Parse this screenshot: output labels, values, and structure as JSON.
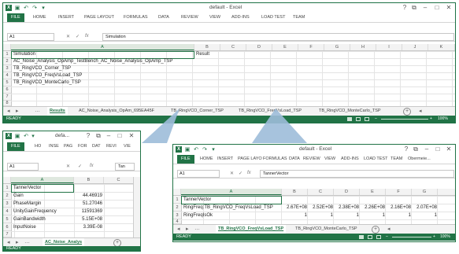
{
  "main": {
    "title": "default - Excel",
    "ribbon": [
      "FILE",
      "HOME",
      "INSERT",
      "PAGE LAYOUT",
      "FORMULAS",
      "DATA",
      "REVIEW",
      "VIEW",
      "ADD-INS",
      "LOAD TEST",
      "TEAM"
    ],
    "name_box": "A1",
    "formula": "Simulation",
    "columns": [
      "A",
      "B",
      "C",
      "D",
      "E",
      "F",
      "G",
      "H",
      "I",
      "J",
      "K"
    ],
    "rows": [
      "1",
      "2",
      "3",
      "4",
      "5",
      "6",
      "7",
      "8"
    ],
    "cells": [
      [
        "Simulation",
        "Result"
      ],
      [
        "AC_Noise_Analysis_OpAmp_TestBench_AC_Noise_Analysis_OpAmp_TSP",
        ""
      ],
      [
        "TB_RingVCO_Corner_TSP",
        ""
      ],
      [
        "TB_RingVCO_FreqVsLoad_TSP",
        ""
      ],
      [
        "TB_RingVCO_MonteCarlo_TSP",
        ""
      ]
    ],
    "tabs": [
      "Results",
      "AC_Noise_Analysis_OpAm_695EA45F",
      "TB_RingVCO_Corner_TSP",
      "TB_RingVCO_FreqVsLoad_TSP",
      "TB_RingVCO_MonteCarlo_TSP"
    ],
    "status": "READY",
    "zoom": "100%"
  },
  "left": {
    "title": "defa...",
    "ribbon": [
      "FILE",
      "HO",
      "INSE",
      "PAG",
      "FOR",
      "DAT",
      "REVI",
      "VIE"
    ],
    "name_box": "A1",
    "formula": "Tan",
    "columns": [
      "A",
      "B",
      "C"
    ],
    "rows": [
      "1",
      "2",
      "3",
      "4",
      "5",
      "6",
      "7",
      "8"
    ],
    "cells": [
      [
        "TannerVector",
        ""
      ],
      [
        "Gain",
        "44.46919"
      ],
      [
        "PhaseMargin",
        "51.27046"
      ],
      [
        "UnityGainFrequency",
        "11591369"
      ],
      [
        "GainBandwidth",
        "5.15E+08"
      ],
      [
        "InputNoise",
        "3.39E-08"
      ]
    ],
    "tab": "AC_Noise_Analys",
    "status": "READY"
  },
  "right": {
    "title": "default - Excel",
    "ribbon": [
      "FILE",
      "HOME",
      "INSERT",
      "PAGE LAYO",
      "FORMULAS",
      "DATA",
      "REVIEW",
      "VIEW",
      "ADD-INS",
      "LOAD TEST",
      "TEAM",
      "Obermeie..."
    ],
    "name_box": "A1",
    "formula": "TannerVector",
    "columns": [
      "A",
      "B",
      "C",
      "D",
      "E",
      "F",
      "G"
    ],
    "rows": [
      "1",
      "2",
      "3",
      "4"
    ],
    "cells": [
      [
        "TannerVector",
        "",
        "",
        "",
        "",
        "",
        ""
      ],
      [
        "RingFreq:TB_RingVCO_FreqVsLoad_TSP",
        "2.67E+08",
        "2.52E+08",
        "2.38E+08",
        "2.26E+08",
        "2.16E+08",
        "2.07E+08"
      ],
      [
        "RingFreqIsOk",
        "1",
        "1",
        "1",
        "1",
        "1",
        "1"
      ]
    ],
    "tabs": [
      "TB_RingVCO_FreqVsLoad_TSP",
      "TB_RingVCO_MonteCarlo_TSP"
    ],
    "status": "READY",
    "zoom": "100%"
  },
  "icons": {
    "excel": "excel-logo-icon",
    "save": "save-icon",
    "undo": "undo-icon",
    "redo": "redo-icon",
    "help": "help-icon",
    "close": "close-icon",
    "add_sheet": "plus-icon"
  },
  "colors": {
    "excel_green": "#217346",
    "callout": "#9dbcd9"
  }
}
